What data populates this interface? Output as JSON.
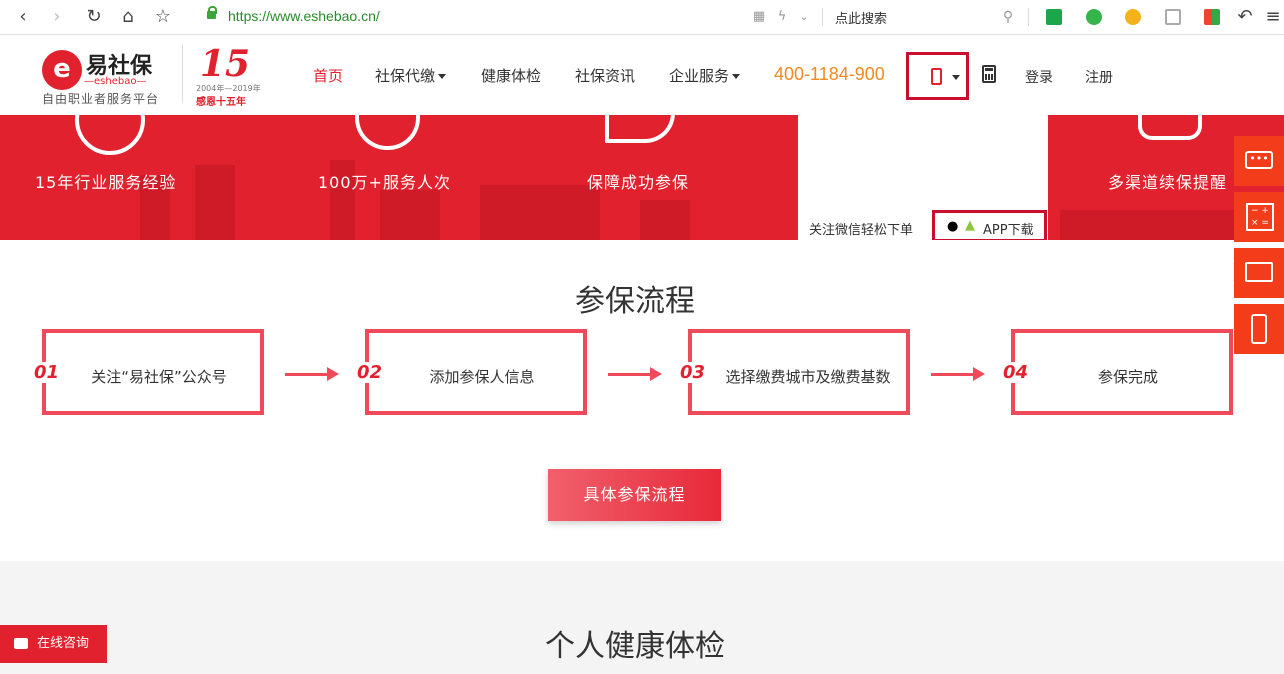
{
  "browser": {
    "url": "https://www.eshebao.cn/",
    "search_placeholder": "点此搜索"
  },
  "logo": {
    "name": "易社保",
    "sub": "—eshebao—",
    "slogan": "自由职业者服务平台",
    "anniv_number": "15",
    "anniv_years": "2004年—2019年",
    "anniv_text": "感恩十五年"
  },
  "nav": {
    "items": [
      "首页",
      "社保代缴",
      "健康体检",
      "社保资讯",
      "企业服务"
    ],
    "phone": "400-1184-900",
    "login": "登录",
    "register": "注册"
  },
  "hero": {
    "items": [
      "15年行业服务经验",
      "100万+服务人次",
      "保障成功参保",
      "多渠道续保提醒"
    ],
    "follow_text": "关注微信轻松下单",
    "app_download": "APP下载"
  },
  "process": {
    "title": "参保流程",
    "steps": [
      {
        "num": "01",
        "text": "关注“易社保”公众号"
      },
      {
        "num": "02",
        "text": "添加参保人信息"
      },
      {
        "num": "03",
        "text": "选择缴费城市及缴费基数"
      },
      {
        "num": "04",
        "text": "参保完成"
      }
    ],
    "detail_button": "具体参保流程"
  },
  "health": {
    "title": "个人健康体检"
  },
  "chat": {
    "label": "在线咨询"
  },
  "colors": {
    "brand_red": "#e2212e",
    "phone_orange": "#f08a24",
    "side_orange": "#f23c1a"
  }
}
